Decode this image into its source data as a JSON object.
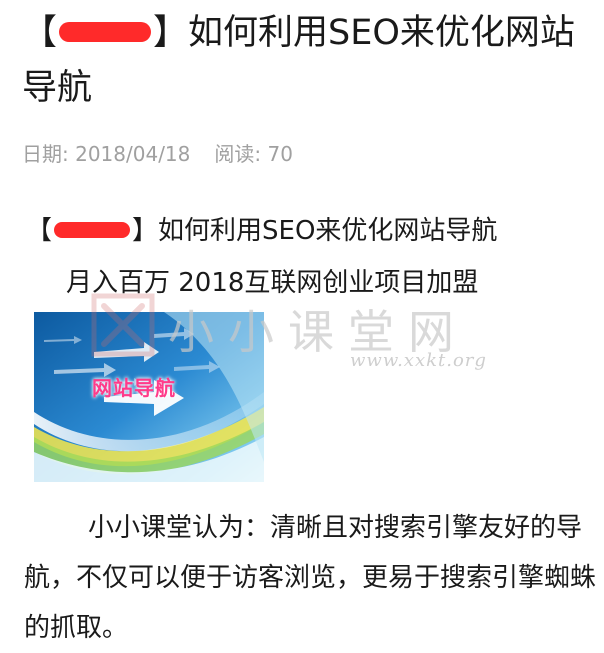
{
  "article": {
    "title_open": "【",
    "title_after_redact": "】如何利用SEO来优化网站导航",
    "meta": {
      "date_label": "日期:",
      "date_value": "2018/04/18",
      "reads_label": "阅读:",
      "reads_value": "70"
    },
    "intro": {
      "line1_open": "【",
      "line1_after_redact": "】如何利用SEO来优化网站导航",
      "line2": "月入百万 2018互联网创业项目加盟"
    },
    "banner": {
      "text": "网站导航"
    },
    "watermark": {
      "brand": "小小课堂网",
      "url": "www.xxkt.org"
    },
    "body": {
      "paragraph": "小小课堂认为：清晰且对搜索引擎友好的导航，不仅可以便于访客浏览，更易于搜索引擎蜘蛛的抓取。"
    }
  },
  "colors": {
    "redaction": "#ff2a2a",
    "meta_text": "#a0a0a0",
    "banner_blue": "#1f77c4"
  }
}
